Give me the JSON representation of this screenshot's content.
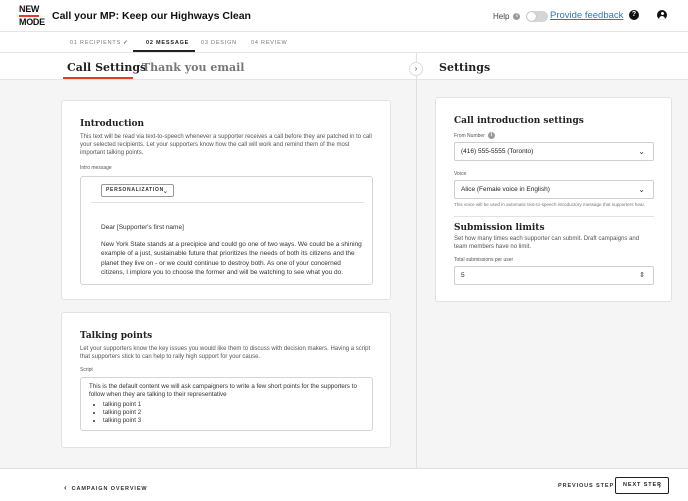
{
  "header": {
    "logo_line1": "NEW",
    "logo_line2": "MODE",
    "title": "Call your MP: Keep our Highways Clean",
    "help_label": "Help",
    "feedback_label": "Provide feedback"
  },
  "stepper": {
    "steps": [
      {
        "label": "01 RECIPIENTS",
        "status": "complete"
      },
      {
        "label": "02 MESSAGE",
        "status": "active"
      },
      {
        "label": "03 DESIGN",
        "status": "upcoming"
      },
      {
        "label": "04 REVIEW",
        "status": "upcoming"
      }
    ]
  },
  "tabs": [
    {
      "label": "Call Settings",
      "active": true
    },
    {
      "label": "Thank you email",
      "active": false
    }
  ],
  "introduction": {
    "heading": "Introduction",
    "description": "This text will be read via text-to-speech whenever a supporter receives a call before they are patched in to call your selected recipients. Let your supporters know how the call will work and remind them of the most important talking points.",
    "field_label": "Intro message",
    "personalization_label": "PERSONALIZATION",
    "greeting": "Dear [Supporter's first name]",
    "body": "New York State stands at a precipice and could go one of two ways. We could be a shining example of a just, sustainable future that prioritizes the needs of both its citizens and the planet they live on - or we could continue to destroy both. As one of your concerned citizens, I implore you to choose the former and will be watching to see what you do."
  },
  "talking_points": {
    "heading": "Talking points",
    "description": "Let your supporters know the key issues you would like them to discuss with decision makers. Having a script that supporters stick to can help to rally high support for your cause.",
    "field_label": "Script",
    "script_intro": "This is the default content we will ask campaigners to write a few short points for the supporters to follow when they are talking to their representative",
    "points": [
      "talking point 1",
      "talking point 2",
      "talking point 3"
    ]
  },
  "settings": {
    "title": "Settings",
    "call_intro_heading": "Call introduction settings",
    "from_number_label": "From Number",
    "from_number_value": "(416) 555-5555 (Toronto)",
    "voice_label": "Voice",
    "voice_value": "Alice (Female voice in English)",
    "voice_help": "This voice will be used in automatic text-to-speech introductory message that supporters hear.",
    "submission_heading": "Submission limits",
    "submission_description": "Set how many times each supporter can submit. Draft campaigns and team members have no limit.",
    "total_label": "Total submissions per user",
    "total_value": "5"
  },
  "footer": {
    "back_label": "CAMPAIGN OVERVIEW",
    "prev_label": "PREVIOUS STEP",
    "next_label": "NEXT STEP"
  },
  "icons": {
    "help_info": "info-icon",
    "question": "question-circle-icon",
    "account": "user-circle-icon",
    "collapse": "chevron-right-icon",
    "select_arrow": "chevron-down-icon",
    "stepper": "updown-stepper-icon"
  },
  "colors": {
    "accent_red": "#e23b2a",
    "link_blue": "#2a7abf",
    "check_green": "#2e8b57"
  }
}
